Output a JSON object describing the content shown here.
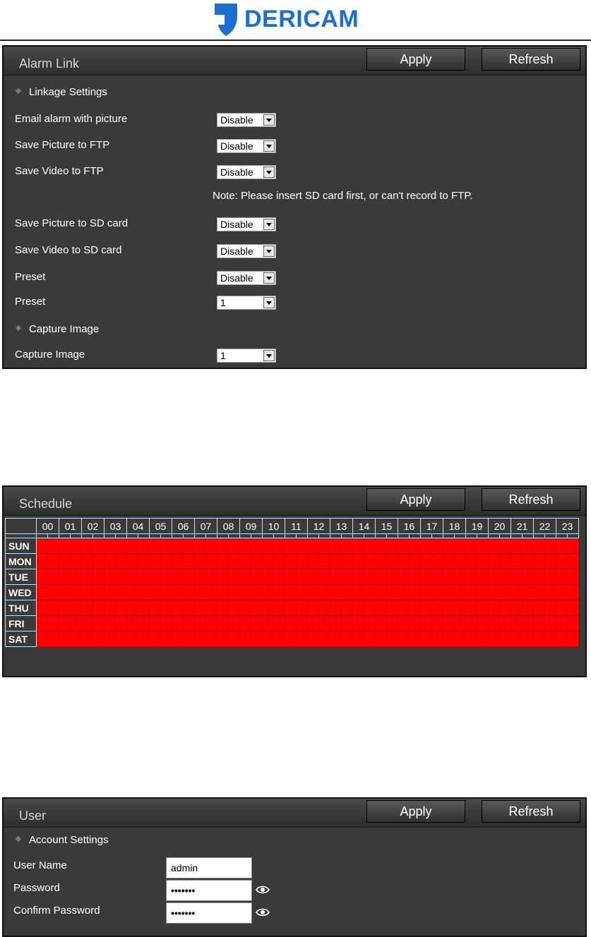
{
  "brand": {
    "name": "DERICAM",
    "color": "#1a6fd1"
  },
  "buttons": {
    "apply": "Apply",
    "refresh": "Refresh"
  },
  "alarm_link": {
    "title": "Alarm Link",
    "section_linkage": "Linkage Settings",
    "rows": [
      {
        "label": "Email alarm with picture",
        "value": "Disable"
      },
      {
        "label": "Save Picture to FTP",
        "value": "Disable"
      },
      {
        "label": "Save Video to FTP",
        "value": "Disable"
      },
      {
        "label": "Save Picture to SD card",
        "value": "Disable"
      },
      {
        "label": "Save Video to SD card",
        "value": "Disable"
      },
      {
        "label": "Preset",
        "value": "Disable"
      },
      {
        "label": "Preset",
        "value": "1"
      }
    ],
    "note": "Note: Please insert SD card first, or can't record to FTP.",
    "section_capture": "Capture Image",
    "capture_label": "Capture Image",
    "capture_value": "1"
  },
  "schedule": {
    "title": "Schedule",
    "hours": [
      "00",
      "01",
      "02",
      "03",
      "04",
      "05",
      "06",
      "07",
      "08",
      "09",
      "10",
      "11",
      "12",
      "13",
      "14",
      "15",
      "16",
      "17",
      "18",
      "19",
      "20",
      "21",
      "22",
      "23"
    ],
    "days": [
      "SUN",
      "MON",
      "TUE",
      "WED",
      "THU",
      "FRI",
      "SAT"
    ],
    "active_color": "#ff0000",
    "all_active": true
  },
  "user": {
    "title": "User",
    "section_account": "Account Settings",
    "username_label": "User Name",
    "username_value": "admin",
    "password_label": "Password",
    "password_value": "•••••••",
    "confirm_label": "Confirm Password",
    "confirm_value": "•••••••",
    "icons": [
      "eye-icon"
    ]
  }
}
